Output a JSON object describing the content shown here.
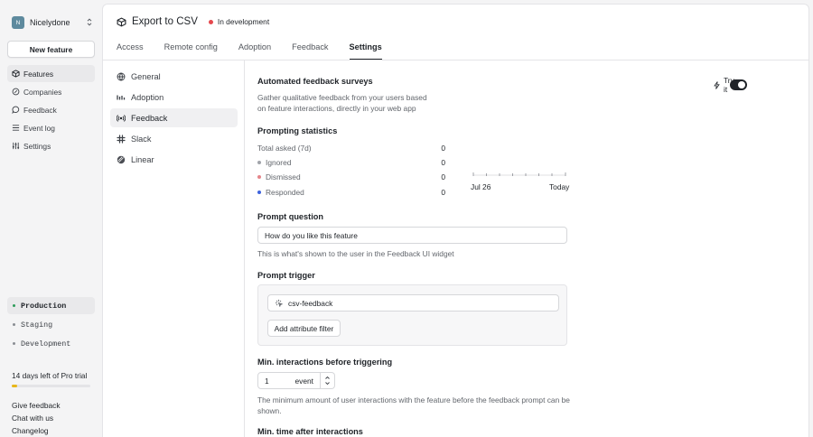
{
  "org": {
    "initial": "N",
    "name": "Nicelydone"
  },
  "sidebar": {
    "new_feature_label": "New feature",
    "nav": [
      {
        "label": "Features",
        "icon": "cube-icon",
        "active": true
      },
      {
        "label": "Companies",
        "icon": "buildings-icon"
      },
      {
        "label": "Feedback",
        "icon": "chat-bubble-icon"
      },
      {
        "label": "Event log",
        "icon": "list-icon"
      },
      {
        "label": "Settings",
        "icon": "sliders-icon"
      }
    ],
    "environments": [
      {
        "label": "Production",
        "active": true
      },
      {
        "label": "Staging"
      },
      {
        "label": "Development"
      }
    ],
    "trial_text": "14 days left of Pro trial",
    "trial_progress": 0.07,
    "footer_links": [
      "Give feedback",
      "Chat with us",
      "Changelog"
    ]
  },
  "header": {
    "title": "Export to CSV",
    "status": "In development",
    "status_color": "#e5484d",
    "tabs": [
      {
        "label": "Access"
      },
      {
        "label": "Remote config"
      },
      {
        "label": "Adoption"
      },
      {
        "label": "Feedback"
      },
      {
        "label": "Settings",
        "active": true
      }
    ]
  },
  "settings_nav": [
    {
      "label": "General",
      "icon": "globe-icon"
    },
    {
      "label": "Adoption",
      "icon": "bars-icon"
    },
    {
      "label": "Feedback",
      "icon": "broadcast-icon",
      "active": true
    },
    {
      "label": "Slack",
      "icon": "slack-icon"
    },
    {
      "label": "Linear",
      "icon": "linear-icon"
    }
  ],
  "feedback": {
    "surveys_title": "Automated feedback surveys",
    "surveys_desc_line1": "Gather qualitative feedback from your users based",
    "surveys_desc_line2": "on feature interactions, directly in your web app",
    "try_label": "Try it",
    "toggle_on": true,
    "stats_title": "Prompting statistics",
    "stats": [
      {
        "label": "Total asked (7d)",
        "value": "0"
      },
      {
        "label": "Ignored",
        "value": "0",
        "color": "#a1a4aa"
      },
      {
        "label": "Dismissed",
        "value": "0",
        "color": "#e5858a"
      },
      {
        "label": "Responded",
        "value": "0",
        "color": "#3e63dd"
      }
    ],
    "timeline_start": "Jul 26",
    "timeline_end": "Today",
    "prompt_question_title": "Prompt question",
    "prompt_question_value": "How do you like this feature",
    "prompt_question_help": "This is what's shown to the user in the Feedback UI widget",
    "prompt_trigger_title": "Prompt trigger",
    "trigger_event": "csv-feedback",
    "add_filter_label": "Add attribute filter",
    "min_interactions_title": "Min. interactions before triggering",
    "min_interactions_value": "1",
    "min_interactions_unit": "event",
    "min_interactions_help_line1": "The minimum amount of user interactions with the feature before the feedback prompt can be",
    "min_interactions_help_line2": "shown.",
    "min_time_title": "Min. time after interactions"
  }
}
